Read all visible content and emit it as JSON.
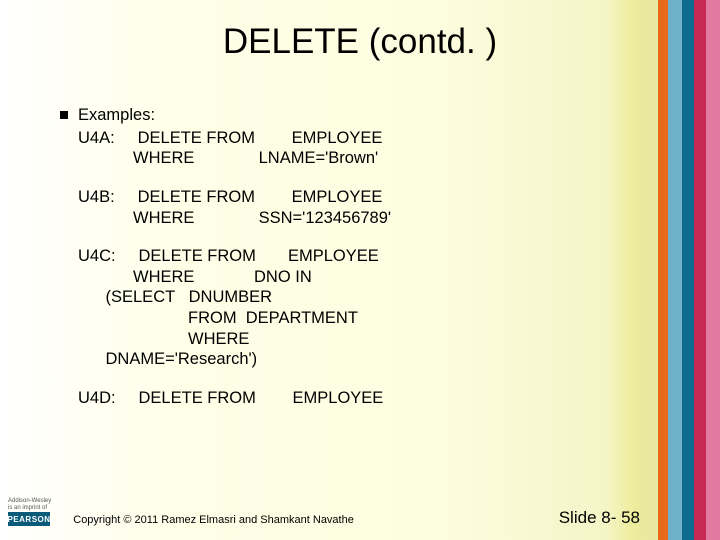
{
  "title": "DELETE (contd. )",
  "bullet_label": "Examples:",
  "examples": {
    "u4a": "U4A:     DELETE FROM        EMPLOYEE\n            WHERE              LNAME='Brown'",
    "u4b": "U4B:     DELETE FROM        EMPLOYEE\n            WHERE              SSN='123456789'",
    "u4c": "U4C:     DELETE FROM       EMPLOYEE\n            WHERE             DNO IN\n      (SELECT   DNUMBER\n                        FROM  DEPARTMENT\n                        WHERE\n      DNAME='Research')",
    "u4d": "U4D:     DELETE FROM        EMPLOYEE"
  },
  "footer": {
    "publisher_line1": "Addison-Wesley",
    "publisher_line2": "is an imprint of",
    "publisher_logo": "PEARSON",
    "copyright": "Copyright © 2011 Ramez Elmasri and Shamkant Navathe",
    "slide_number": "Slide 8- 58"
  }
}
